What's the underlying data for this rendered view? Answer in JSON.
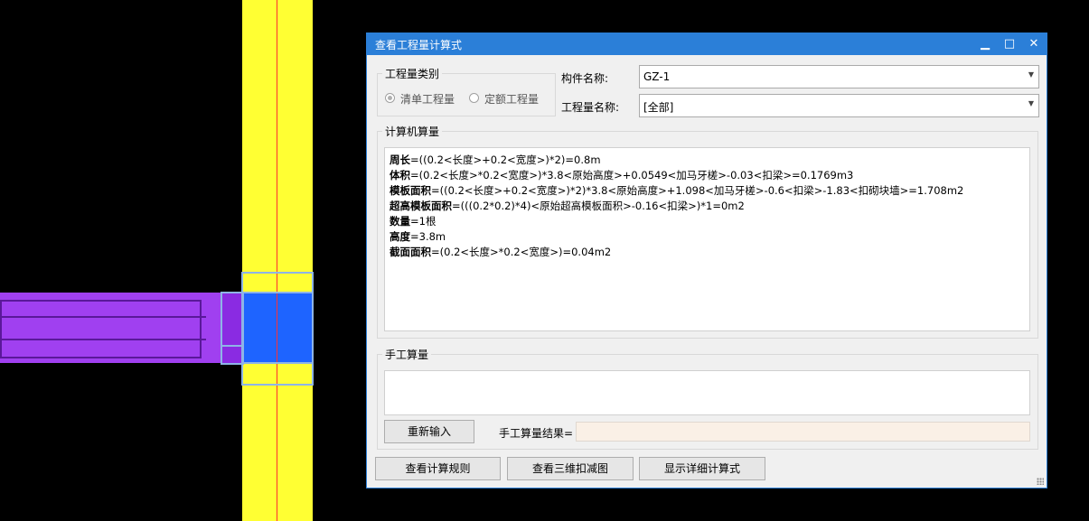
{
  "dialog": {
    "title": "查看工程量计算式",
    "window_buttons": {
      "minimize": "▁",
      "maximize": "□",
      "close": "✕"
    },
    "quantity_type": {
      "legend": "工程量类别",
      "options": [
        {
          "label": "清单工程量",
          "checked": true
        },
        {
          "label": "定额工程量",
          "checked": false
        }
      ]
    },
    "component_name": {
      "label": "构件名称:",
      "value": "GZ-1"
    },
    "quantity_name": {
      "label": "工程量名称:",
      "value": "[全部]"
    },
    "computer_calc": {
      "legend": "计算机算量",
      "lines": [
        {
          "name": "周长",
          "formula": "=((0.2<长度>+0.2<宽度>)*2)=0.8m"
        },
        {
          "name": "体积",
          "formula": "=(0.2<长度>*0.2<宽度>)*3.8<原始高度>+0.0549<加马牙槎>-0.03<扣梁>=0.1769m3"
        },
        {
          "name": "模板面积",
          "formula": "=((0.2<长度>+0.2<宽度>)*2)*3.8<原始高度>+1.098<加马牙槎>-0.6<扣梁>-1.83<扣砌块墙>=1.708m2"
        },
        {
          "name": "超高模板面积",
          "formula": "=(((0.2*0.2)*4)<原始超高模板面积>-0.16<扣梁>)*1=0m2"
        },
        {
          "name": "数量",
          "formula": "=1根"
        },
        {
          "name": "高度",
          "formula": "=3.8m"
        },
        {
          "name": "截面面积",
          "formula": "=(0.2<长度>*0.2<宽度>)=0.04m2"
        }
      ]
    },
    "manual_calc": {
      "legend": "手工算量",
      "input_value": "",
      "reenter_button": "重新输入",
      "result_label": "手工算量结果=",
      "result_value": ""
    },
    "bottom_buttons": {
      "view_rules": "查看计算规则",
      "view_3d": "查看三维扣减图",
      "show_detail": "显示详细计算式"
    }
  },
  "colors": {
    "column": "#ffff33",
    "axis": "#ff3030",
    "beam": "#a040f0",
    "joint": "#1e64ff",
    "titlebar": "#2b7fd8"
  }
}
